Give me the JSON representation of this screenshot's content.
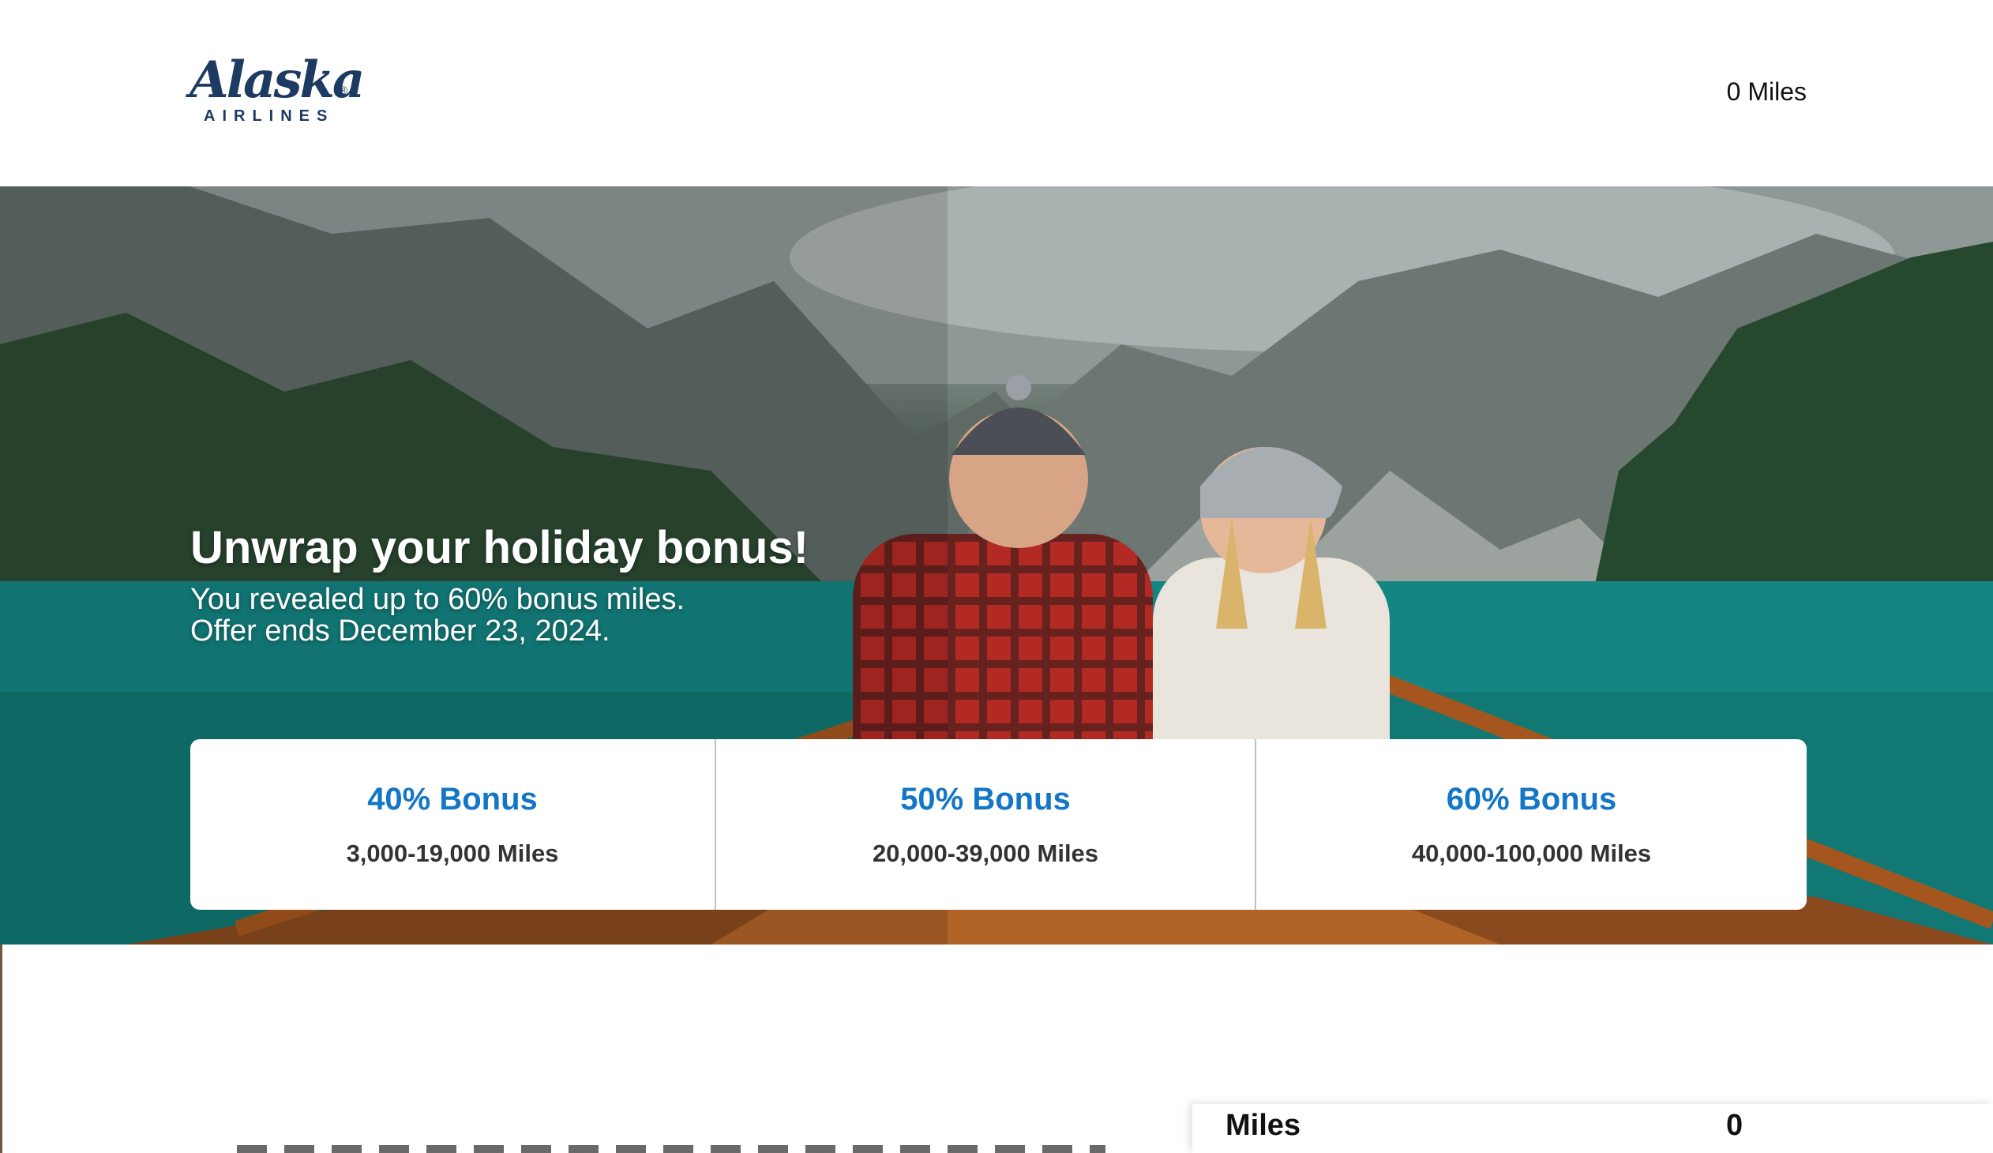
{
  "header": {
    "logo": {
      "wordmark": "Alaska",
      "subline": "AIRLINES",
      "registered": "®"
    },
    "miles_balance": "0 Miles"
  },
  "hero": {
    "title": "Unwrap your holiday bonus!",
    "subtitle_line1": "You revealed up to 60% bonus miles.",
    "subtitle_line2": "Offer ends December 23, 2024."
  },
  "tiers": [
    {
      "title": "40% Bonus",
      "range": "3,000-19,000 Miles"
    },
    {
      "title": "50% Bonus",
      "range": "20,000-39,000 Miles"
    },
    {
      "title": "60% Bonus",
      "range": "40,000-100,000 Miles"
    }
  ],
  "summary": {
    "label": "Miles",
    "value": "0"
  },
  "colors": {
    "brand_navy": "#1d3a63",
    "tier_blue": "#1376c6",
    "lake_teal": "#158a86"
  },
  "icons": [
    "alaska-airlines-logo"
  ]
}
